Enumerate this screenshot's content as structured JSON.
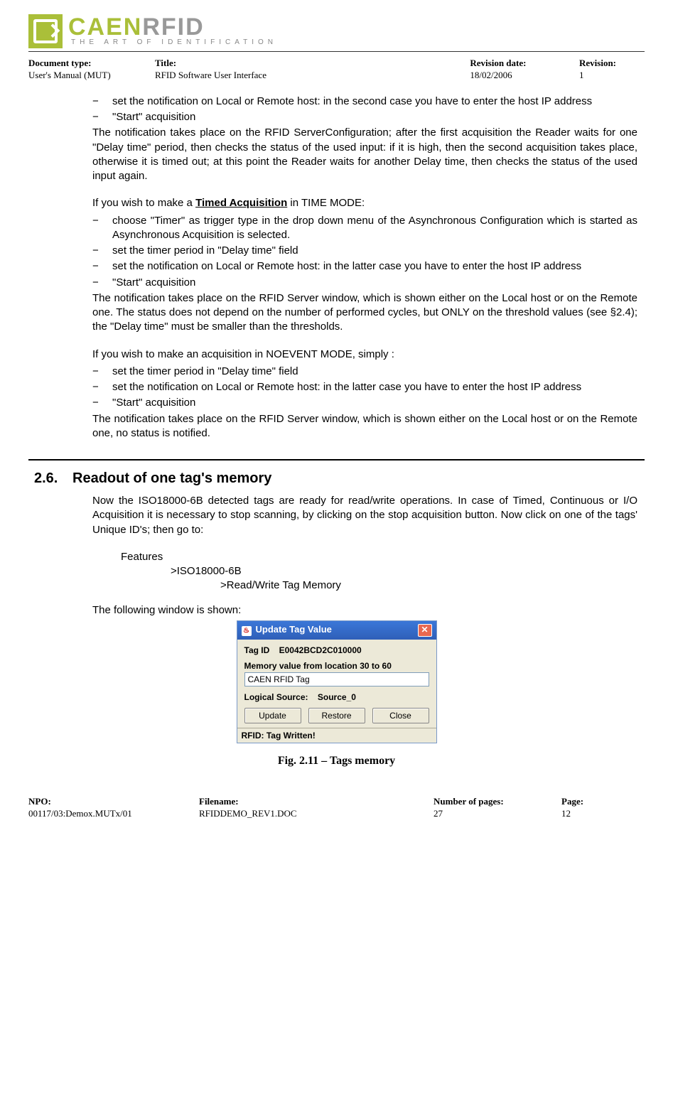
{
  "logo": {
    "main": "CAEN",
    "suffix": "RFID",
    "tagline": "THE ART OF IDENTIFICATION"
  },
  "header": {
    "doc_type_lbl": "Document type:",
    "doc_type_val": "User's Manual (MUT)",
    "title_lbl": "Title:",
    "title_val": "RFID Software User Interface",
    "rev_date_lbl": "Revision date:",
    "rev_date_val": "18/02/2006",
    "rev_lbl": "Revision:",
    "rev_val": "1"
  },
  "body": {
    "b1": "set the notification on Local or Remote host: in the second case you have to enter the host IP address",
    "b2": "\"Start\" acquisition",
    "p1": "The notification takes place on the RFID ServerConfiguration; after the first acquisition the Reader waits for one \"Delay time\" period, then checks the status of the used input: if it is high, then the second acquisition takes place, otherwise it is timed out; at this point the Reader waits for another Delay time, then checks the status of the used input again.",
    "p2a": "If you wish to make a ",
    "p2b": "Timed Acquisition",
    "p2c": " in TIME MODE:",
    "b3": "choose \"Timer\" as trigger type in the drop down menu of the Asynchronous Configuration which is started as Asynchronous Acquisition is selected.",
    "b4": "set the timer period in \"Delay time\" field",
    "b5": "set the notification on Local or Remote host: in the latter case you have to enter the host IP address",
    "b6": "\"Start\" acquisition",
    "p3": "The notification takes place on the RFID Server window, which is shown either on the Local host or on the Remote one. The status does not depend on the number of performed cycles, but ONLY on the threshold values (see §2.4); the \"Delay time\" must be smaller than the thresholds.",
    "p4": "If you wish to make an acquisition in NOEVENT MODE, simply :",
    "b7": "set the timer period in \"Delay time\" field",
    "b8": "set the notification on Local or Remote host: in the latter case you have to enter the host IP address",
    "b9": "\"Start\" acquisition",
    "p5": "The notification takes place on the RFID Server window, which is shown either on the Local host or on the Remote one, no status is notified."
  },
  "section": {
    "num": "2.6.",
    "title": "Readout of one tag's memory",
    "intro": "Now the ISO18000-6B detected tags are ready for read/write operations. In case of Timed, Continuous or I/O Acquisition it is necessary to stop scanning, by clicking on the stop acquisition button. Now click on one of the tags' Unique ID's; then go to:",
    "nav1": "Features",
    "nav2": ">ISO18000-6B",
    "nav3": ">Read/Write Tag Memory",
    "lead": "The following window is shown:"
  },
  "dialog": {
    "title": "Update Tag Value",
    "tag_id_lbl": "Tag ID",
    "tag_id_val": "E0042BCD2C010000",
    "mem_lbl": "Memory value from location 30 to 60",
    "mem_val": "CAEN RFID Tag",
    "src_lbl": "Logical Source:",
    "src_val": "Source_0",
    "btn_update": "Update",
    "btn_restore": "Restore",
    "btn_close": "Close",
    "status": "RFID: Tag Written!"
  },
  "figure": "Fig. 2.11 – Tags memory",
  "footer": {
    "npo_lbl": "NPO:",
    "npo_val": "00117/03:Demox.MUTx/01",
    "file_lbl": "Filename:",
    "file_val": "RFIDDEMO_REV1.DOC",
    "pages_lbl": "Number of pages:",
    "pages_val": "27",
    "page_lbl": "Page:",
    "page_val": "12"
  }
}
